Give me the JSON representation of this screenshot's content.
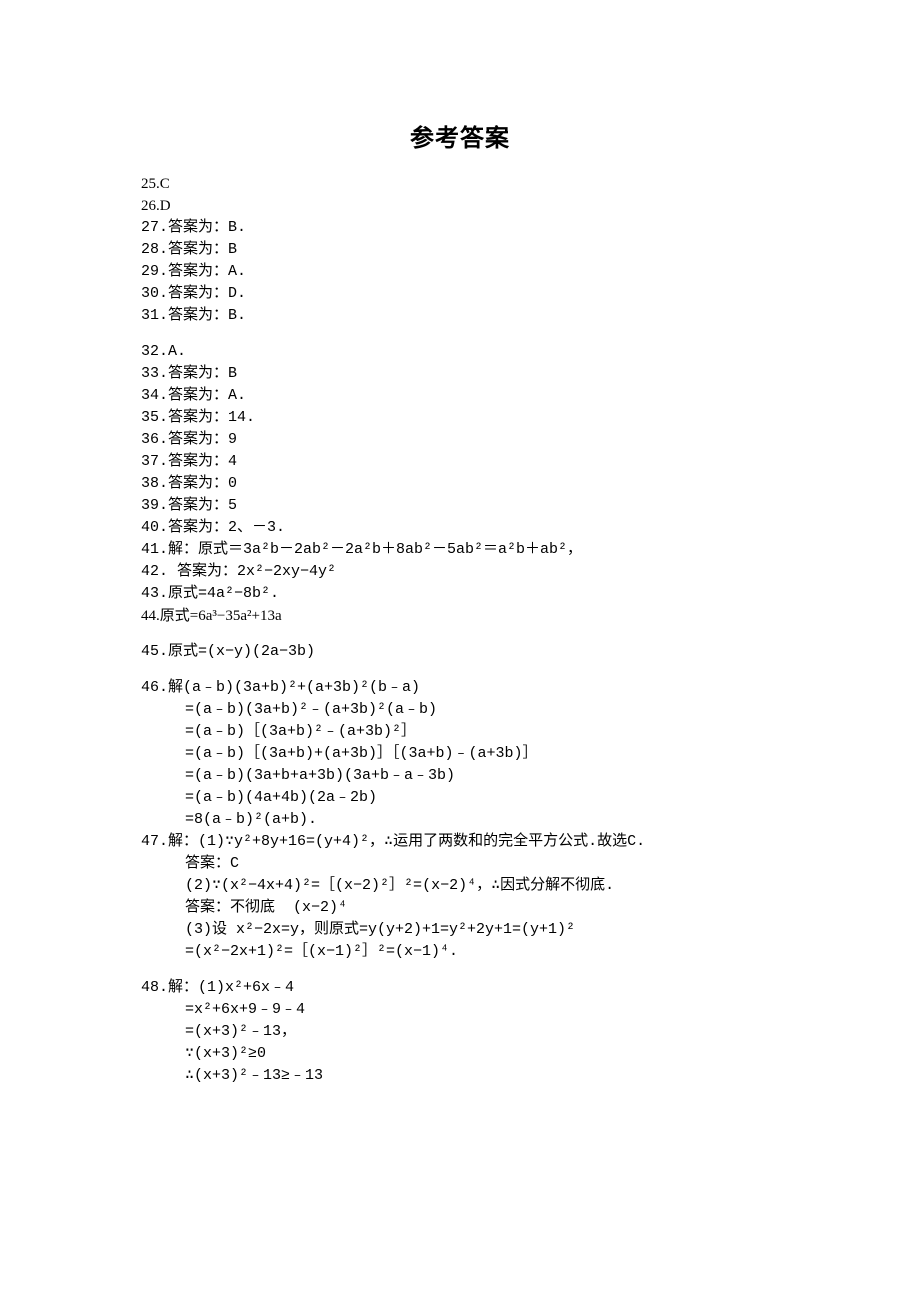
{
  "title": "参考答案",
  "lines": {
    "l25": "25.C",
    "l26": "26.D",
    "l27": "27.答案为：B.",
    "l28": "28.答案为：B",
    "l29": "29.答案为：A.",
    "l30": "30.答案为：D.",
    "l31": "31.答案为：B.",
    "l32": "32.A.",
    "l33": "33.答案为：B",
    "l34": "34.答案为：A.",
    "l35": "35.答案为：14.",
    "l36": "36.答案为：9",
    "l37": "37.答案为：4",
    "l38": "38.答案为：0",
    "l39": "39.答案为：5",
    "l40": "40.答案为：2、－3.",
    "l41": "41.解：原式＝3a²b－2ab²－2a²b＋8ab²－5ab²＝a²b＋ab²，",
    "l42": "42. 答案为：2x²−2xy−4y²",
    "l43": "43.原式=4a²−8b².",
    "l44": "44.原式=6a³−35a²+13a",
    "l45": "45.原式=(x−y)(2a−3b)",
    "l46a": "46.解(a﹣b)(3a+b)²+(a+3b)²(b﹣a)",
    "l46b": "=(a﹣b)(3a+b)²﹣(a+3b)²(a﹣b)",
    "l46c": "=(a﹣b)［(3a+b)²﹣(a+3b)²］",
    "l46d": "=(a﹣b)［(3a+b)+(a+3b)］［(3a+b)﹣(a+3b)］",
    "l46e": "=(a﹣b)(3a+b+a+3b)(3a+b﹣a﹣3b)",
    "l46f": "=(a﹣b)(4a+4b)(2a﹣2b)",
    "l46g": "=8(a﹣b)²(a+b).",
    "l47a": "47.解：(1)∵y²+8y+16=(y+4)²，∴运用了两数和的完全平方公式.故选C.",
    "l47b": "答案：C",
    "l47c": "(2)∵(x²−4x+4)²=［(x−2)²］²=(x−2)⁴，∴因式分解不彻底.",
    "l47d": "答案：不彻底  (x−2)⁴",
    "l47e": "(3)设 x²−2x=y，则原式=y(y+2)+1=y²+2y+1=(y+1)²",
    "l47f": "=(x²−2x+1)²=［(x−1)²］²=(x−1)⁴.",
    "l48a": "48.解：(1)x²+6x﹣4",
    "l48b": "=x²+6x+9﹣9﹣4",
    "l48c": "=(x+3)²﹣13，",
    "l48d": "∵(x+3)²≥0",
    "l48e": "∴(x+3)²﹣13≥﹣13"
  }
}
